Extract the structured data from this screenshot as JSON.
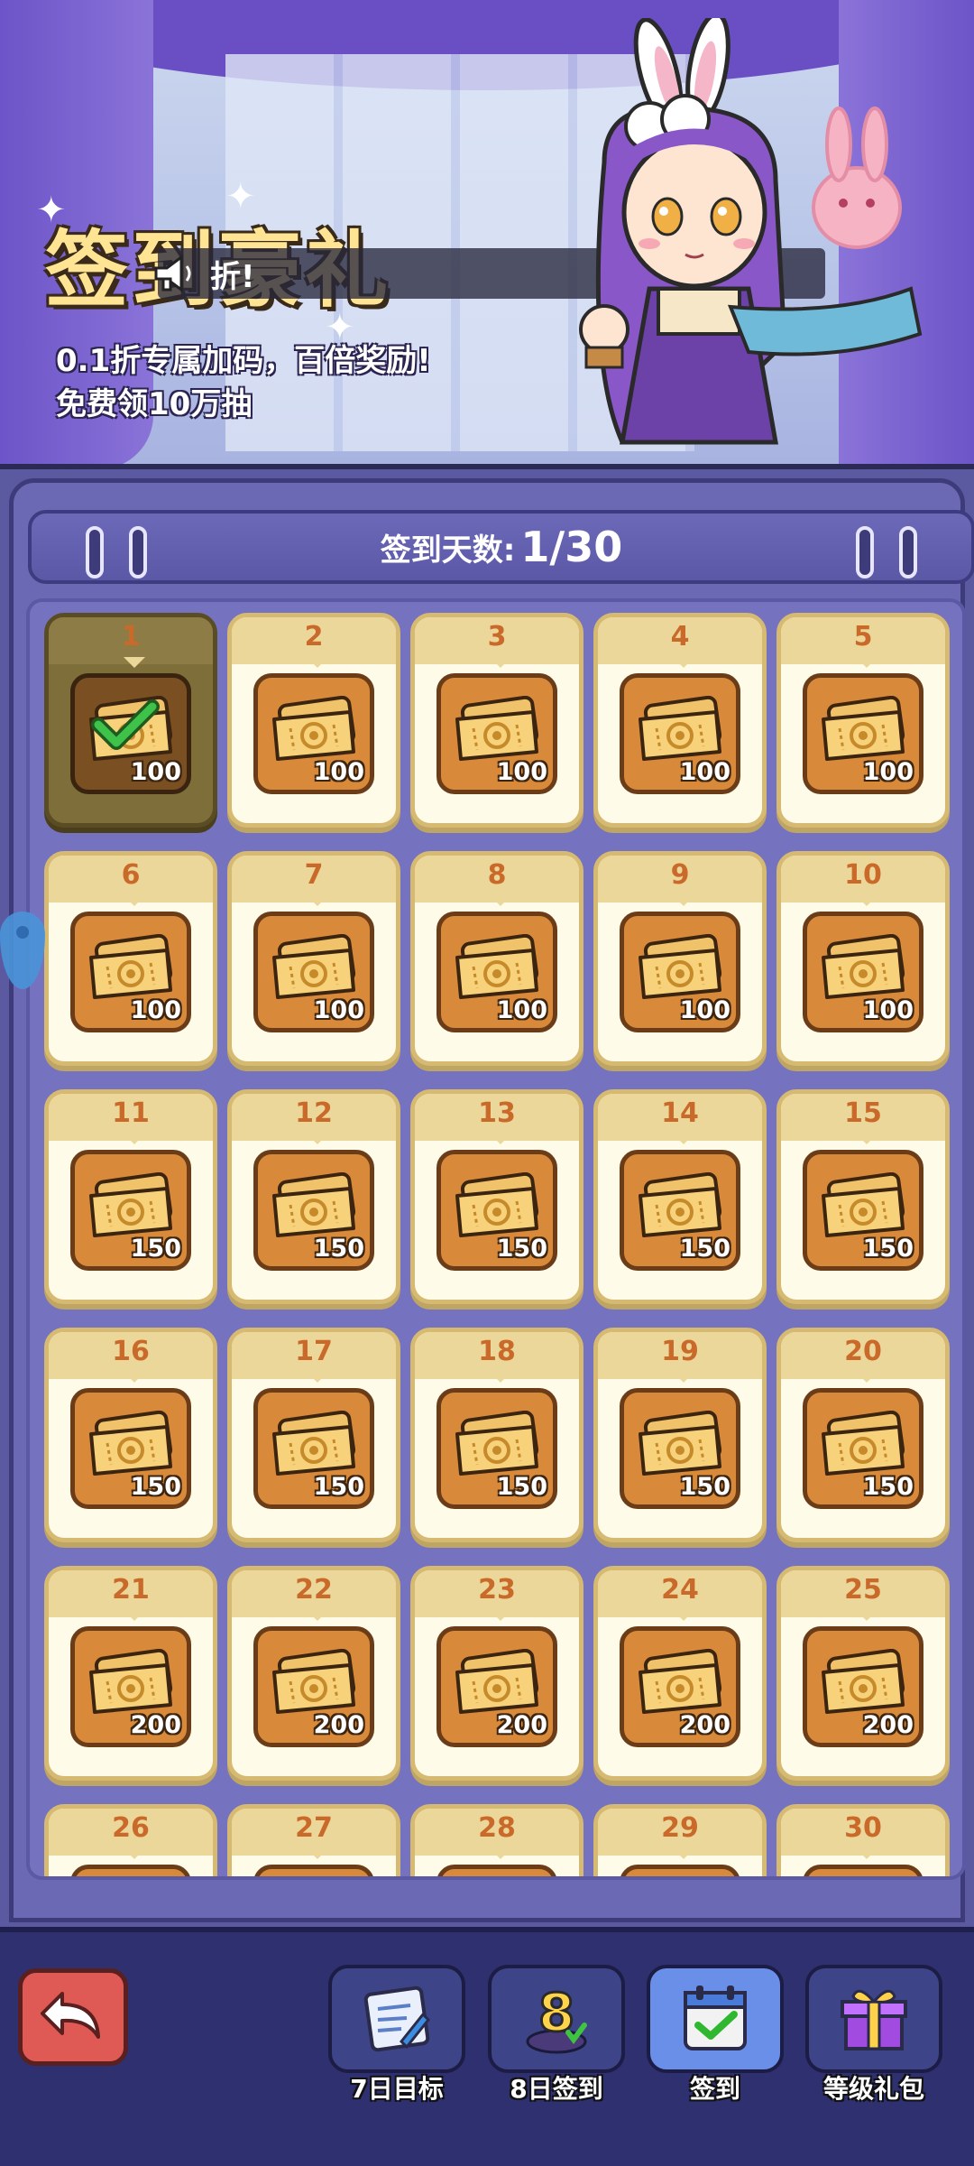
{
  "banner": {
    "title": "签到豪礼",
    "toast_text": "折!",
    "subtitle_line1": "0.1折专属加码，百倍奖励!",
    "subtitle_line2": "免费领10万抽"
  },
  "board": {
    "header_label": "签到天数:",
    "header_count": "1/30"
  },
  "days": [
    {
      "day": "1",
      "qty": "100",
      "claimed": true
    },
    {
      "day": "2",
      "qty": "100"
    },
    {
      "day": "3",
      "qty": "100"
    },
    {
      "day": "4",
      "qty": "100"
    },
    {
      "day": "5",
      "qty": "100"
    },
    {
      "day": "6",
      "qty": "100"
    },
    {
      "day": "7",
      "qty": "100"
    },
    {
      "day": "8",
      "qty": "100"
    },
    {
      "day": "9",
      "qty": "100"
    },
    {
      "day": "10",
      "qty": "100"
    },
    {
      "day": "11",
      "qty": "150"
    },
    {
      "day": "12",
      "qty": "150"
    },
    {
      "day": "13",
      "qty": "150"
    },
    {
      "day": "14",
      "qty": "150"
    },
    {
      "day": "15",
      "qty": "150"
    },
    {
      "day": "16",
      "qty": "150"
    },
    {
      "day": "17",
      "qty": "150"
    },
    {
      "day": "18",
      "qty": "150"
    },
    {
      "day": "19",
      "qty": "150"
    },
    {
      "day": "20",
      "qty": "150"
    },
    {
      "day": "21",
      "qty": "200"
    },
    {
      "day": "22",
      "qty": "200"
    },
    {
      "day": "23",
      "qty": "200"
    },
    {
      "day": "24",
      "qty": "200"
    },
    {
      "day": "25",
      "qty": "200"
    },
    {
      "day": "26",
      "qty": ""
    },
    {
      "day": "27",
      "qty": ""
    },
    {
      "day": "28",
      "qty": ""
    },
    {
      "day": "29",
      "qty": ""
    },
    {
      "day": "30",
      "qty": ""
    }
  ],
  "nav": [
    {
      "label": "7日目标",
      "icon": "scroll-map-icon"
    },
    {
      "label": "8日签到",
      "icon": "number-8-badge-icon"
    },
    {
      "label": "签到",
      "icon": "calendar-check-icon",
      "active": true
    },
    {
      "label": "等级礼包",
      "icon": "gift-box-icon"
    }
  ],
  "colors": {
    "board_bg": "#6b68b4",
    "cell_bg": "#fffbe9",
    "cell_day": "#c96a2a",
    "ticket_box": "#d88a3a",
    "nav_active": "#6a8fe8"
  }
}
